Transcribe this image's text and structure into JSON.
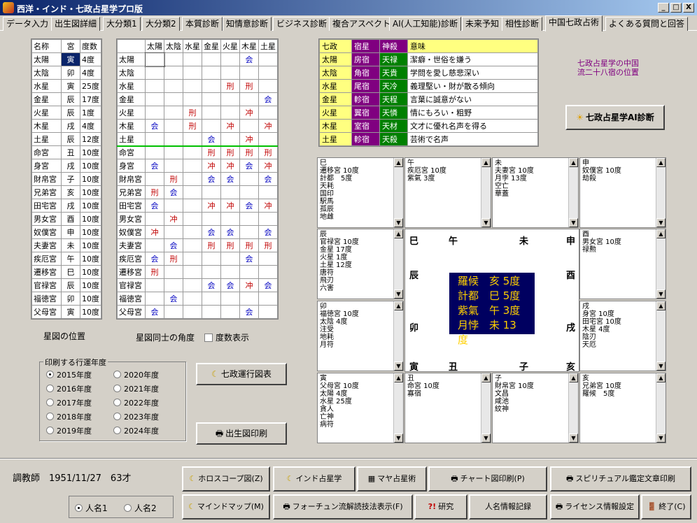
{
  "window": {
    "title": "西洋・インド・七政占星学プロ版",
    "controls": [
      "_",
      "□",
      "X"
    ]
  },
  "tabs": [
    "データ入力",
    "出生図詳細",
    "大分類1",
    "大分類2",
    "本質診断",
    "知情意診断",
    "ビジネス診断",
    "複合アスペクト",
    "AI(人工知能)診断",
    "未来予知",
    "相性診断",
    "中国七政占術",
    "よくある質問と回答"
  ],
  "planets_table": {
    "headers": [
      "名称",
      "宮",
      "度数"
    ],
    "rows": [
      [
        "太陽",
        "寅",
        "4度"
      ],
      [
        "太陰",
        "卯",
        "4度"
      ],
      [
        "水星",
        "寅",
        "25度"
      ],
      [
        "金星",
        "辰",
        "17度"
      ],
      [
        "火星",
        "辰",
        "1度"
      ],
      [
        "木星",
        "戌",
        "4度"
      ],
      [
        "土星",
        "辰",
        "12度"
      ],
      [
        "命宮",
        "丑",
        "10度"
      ],
      [
        "身宮",
        "戌",
        "10度"
      ],
      [
        "財帛宮",
        "子",
        "10度"
      ],
      [
        "兄弟宮",
        "亥",
        "10度"
      ],
      [
        "田宅宮",
        "戌",
        "10度"
      ],
      [
        "男女宮",
        "酉",
        "10度"
      ],
      [
        "奴僕宮",
        "申",
        "10度"
      ],
      [
        "夫妻宮",
        "未",
        "10度"
      ],
      [
        "疾厄宮",
        "午",
        "10度"
      ],
      [
        "遷移宮",
        "巳",
        "10度"
      ],
      [
        "官禄宮",
        "辰",
        "10度"
      ],
      [
        "福徳宮",
        "卯",
        "10度"
      ],
      [
        "父母宮",
        "寅",
        "10度"
      ]
    ]
  },
  "aspect_table": {
    "cols": [
      "太陽",
      "太陰",
      "水星",
      "金星",
      "火星",
      "木星",
      "土星"
    ],
    "rows": [
      [
        "太陽",
        [
          "",
          "",
          "",
          "",
          "",
          "会",
          ""
        ]
      ],
      [
        "太陰",
        [
          "",
          "",
          "",
          "",
          "",
          "",
          ""
        ]
      ],
      [
        "水星",
        [
          "",
          "",
          "",
          "",
          "刑",
          "刑",
          ""
        ]
      ],
      [
        "金星",
        [
          "",
          "",
          "",
          "",
          "",
          "",
          "会"
        ]
      ],
      [
        "火星",
        [
          "",
          "",
          "刑",
          "",
          "",
          "冲",
          ""
        ]
      ],
      [
        "木星",
        [
          "会",
          "",
          "刑",
          "",
          "冲",
          "",
          "冲"
        ]
      ],
      [
        "土星",
        [
          "",
          "",
          "",
          "会",
          "",
          "冲",
          ""
        ]
      ],
      [
        "命宮",
        [
          "",
          "",
          "",
          "刑",
          "刑",
          "刑",
          "刑"
        ]
      ],
      [
        "身宮",
        [
          "会",
          "",
          "",
          "冲",
          "冲",
          "会",
          "冲"
        ]
      ],
      [
        "財帛宮",
        [
          "",
          "刑",
          "",
          "会",
          "会",
          "",
          "会"
        ]
      ],
      [
        "兄弟宮",
        [
          "刑",
          "会",
          "",
          "",
          "",
          "",
          ""
        ]
      ],
      [
        "田宅宮",
        [
          "会",
          "",
          "",
          "冲",
          "冲",
          "会",
          "冲"
        ]
      ],
      [
        "男女宮",
        [
          "",
          "冲",
          "",
          "",
          "",
          "",
          ""
        ]
      ],
      [
        "奴僕宮",
        [
          "冲",
          "",
          "",
          "会",
          "会",
          "",
          "会"
        ]
      ],
      [
        "夫妻宮",
        [
          "",
          "会",
          "",
          "刑",
          "刑",
          "刑",
          "刑"
        ]
      ],
      [
        "疾厄宮",
        [
          "会",
          "刑",
          "",
          "",
          "",
          "会",
          ""
        ]
      ],
      [
        "遷移宮",
        [
          "刑",
          "",
          "",
          "",
          "",
          "",
          ""
        ]
      ],
      [
        "官禄宮",
        [
          "",
          "",
          "",
          "会",
          "会",
          "冲",
          "会"
        ]
      ],
      [
        "福徳宮",
        [
          "",
          "会",
          "",
          "",
          "",
          "",
          ""
        ]
      ],
      [
        "父母宮",
        [
          "会",
          "",
          "",
          "",
          "",
          "会",
          ""
        ]
      ]
    ]
  },
  "labels": {
    "star_pos": "星図の位置",
    "star_angle": "星図同士の角度",
    "degree_show": "度数表示",
    "print_year": "印刷する行運年度",
    "cn_title_1": "七政占星学の中国",
    "cn_title_2": "流二十八宿の位置"
  },
  "years": [
    "2015年度",
    "2016年度",
    "2017年度",
    "2018年度",
    "2019年度",
    "2020年度",
    "2021年度",
    "2022年度",
    "2023年度",
    "2024年度"
  ],
  "seven_table": {
    "headers": [
      "七政",
      "宿星",
      "神殺",
      "意味"
    ],
    "rows": [
      [
        "太陽",
        "房宿",
        "天禄",
        "潔癖・世俗を嫌う"
      ],
      [
        "太陰",
        "角宿",
        "天貴",
        "学問を愛し慈悲深い"
      ],
      [
        "水星",
        "尾宿",
        "天冷",
        "義理堅い・財が散る傾向"
      ],
      [
        "金星",
        "軫宿",
        "天程",
        "言葉に誠意がない"
      ],
      [
        "火星",
        "翼宿",
        "天憐",
        "情にもろい・粗野"
      ],
      [
        "木星",
        "室宿",
        "天材",
        "文才に優れ名声を得る"
      ],
      [
        "土星",
        "軫宿",
        "天殺",
        "芸術で名声"
      ]
    ]
  },
  "buttons": {
    "ai": "七政占星学AI診断",
    "unko": "七政運行図表",
    "print_birth": "出生図印刷",
    "horoscope": "ホロスコープ図(Z)",
    "india": "インド占星学",
    "maya": "マヤ占星術",
    "chart_print": "チャート図印刷(P)",
    "spiritual": "スピリチュアル鑑定文章印刷",
    "mindmap": "マインドマップ(M)",
    "fortune": "フォーチュン流解読技法表示(F)",
    "research": "研究",
    "person": "人名情報記録",
    "license": "ライセンス情報設定",
    "exit": "終了(C)"
  },
  "palaces": {
    "si": "巳\n遷移宮 10度\n計都　5度\n天耗\n国印\n駅馬\n孤辰\n地雌",
    "wu": "午\n疾厄宮 10度\n紫氣 3度",
    "wei": "未\n夫妻宮 10度\n月孛 13度\n空亡\n華蓋",
    "shen": "申\n奴僕宮 10度\n劫殺",
    "chen": "辰\n官禄宮 10度\n金星 17度\n火星 1度\n土星 12度\n唐符\n飛刃\n六害",
    "you": "酉\n男女宮 10度\n禄勲",
    "mao": "卯\n福徳宮 10度\n太陰 4度\n注受\n地耗\n月符",
    "xu": "戌\n身宮 10度\n田宅宮 10度\n木星 4度\n陰刃\n天厄",
    "yin": "寅\n父母宮 10度\n太陽 4度\n水星 25度\n貪人\n亡神\n病符",
    "chou": "丑\n命宮 10度\n寡宿",
    "zi": "子\n財帛宮 10度\n文昌\n咸池\n紋神",
    "hai": "亥\n兄弟宮 10度\n羅候　5度"
  },
  "center": {
    "branches": [
      "巳",
      "午",
      "未",
      "申",
      "辰",
      "酉",
      "卯",
      "戌",
      "寅",
      "丑",
      "子",
      "亥"
    ],
    "lines": [
      "羅候　亥 5度",
      "計都　巳 5度",
      "紫氣　午 3度",
      "月悖　未 13度"
    ]
  },
  "person": {
    "info": "調教師　1951/11/27　63才",
    "name1": "人名1",
    "name2": "人名2"
  },
  "colors": {
    "title_start": "#0a246a",
    "highlight": "#ffff80",
    "purple": "#800080",
    "green": "#008000",
    "navy_box": "#000060",
    "gold_text": "#ffd000"
  }
}
